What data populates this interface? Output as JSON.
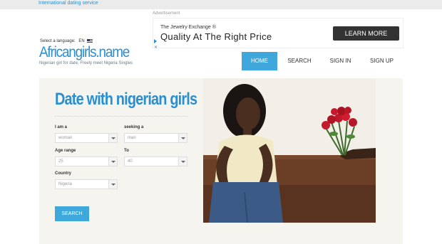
{
  "topbar": {
    "tagline": "International dating service"
  },
  "header": {
    "language_label": "Select a language:",
    "language_code": "EN",
    "logo": "Africangirls.name",
    "subtitle": "Nigerian girl for date, Freely meet Nigeria Singles"
  },
  "ad": {
    "label": "Advertisement",
    "brand": "The Jewelry Exchange ®",
    "headline": "Quality At The Right Price",
    "cta": "LEARN MORE"
  },
  "nav": {
    "items": [
      "HOME",
      "SEARCH",
      "SIGN IN",
      "SIGN UP"
    ],
    "active": "HOME"
  },
  "form": {
    "heading": "Date with nigerian girls",
    "i_am_label": "I am a",
    "i_am_value": "woman",
    "seeking_label": "seeking a",
    "seeking_value": "man",
    "age_label": "Age range",
    "age_from": "25",
    "to_label": "To",
    "age_to": "40",
    "country_label": "Country",
    "country_value": "Nigeria",
    "search_button": "SEARCH"
  },
  "colors": {
    "accent": "#3ea8dc",
    "brand_blue": "#2a8fcf",
    "panel_bg": "#f6f4ef",
    "topbar_bg": "#ebebeb",
    "ad_button": "#333333"
  }
}
